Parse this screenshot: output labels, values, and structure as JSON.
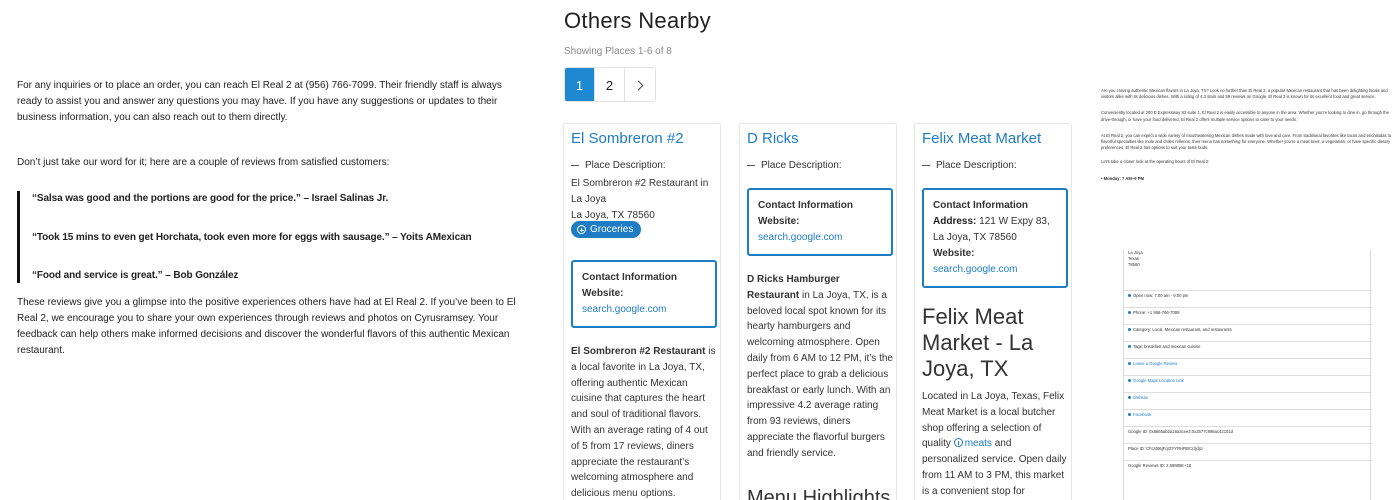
{
  "article": {
    "intro": "For any inquiries or to place an order, you can reach El Real 2 at (956) 766-7099. Their friendly staff is always ready to assist you and answer any questions you may have. If you have any suggestions or updates to their business information, you can also reach out to them directly.",
    "lead": "Don’t just take our word for it; here are a couple of reviews from satisfied customers:",
    "quotes": [
      "“Salsa was good and the portions are good for the price.” – Israel Salinas Jr.",
      "“Took 15 mins to even get Horchata, took even more for eggs with sausage.” – Yoits AMexican",
      "“Food and service is great.” – Bob González"
    ],
    "outro": "These reviews give you a glimpse into the positive experiences others have had at El Real 2. If you’ve been to El Real 2, we encourage you to share your own experiences through reviews and photos on Cyrusramsey. Your feedback can help others make informed decisions and discover the wonderful flavors of this authentic Mexican restaurant."
  },
  "nearby": {
    "title": "Others Nearby",
    "showing": "Showing Places 1-6 of 8",
    "pages": [
      "1",
      "2"
    ],
    "active_page": "1"
  },
  "cards": [
    {
      "title": "El Sombreron #2",
      "place_desc_label": "Place Description:",
      "address_lines": [
        "El Sombreron #2 Restaurant in La Joya",
        "La Joya, TX 78560"
      ],
      "chip": "Groceries",
      "contact_label": "Contact Information",
      "website_label": "Website:",
      "website": "search.google.com",
      "desc_bold": "El Sombreron #2 Restaurant",
      "desc_rest": " is a local favorite in La Joya, TX, offering authentic Mexican cuisine that captures the heart and soul of traditional flavors. With an average rating of 4 out of 5 from 17 reviews, diners appreciate the restaurant’s welcoming atmosphere and delicious menu options."
    },
    {
      "title": "D Ricks",
      "place_desc_label": "Place Description:",
      "contact_label": "Contact Information",
      "website_label": "Website:",
      "website": "search.google.com",
      "desc_bold": "D Ricks Hamburger Restaurant",
      "desc_rest": " in La Joya, TX, is a beloved local spot known for its hearty hamburgers and welcoming atmosphere. Open daily from 6 AM to 12 PM, it’s the perfect place to grab a delicious breakfast or early lunch. With an impressive 4.2 average rating from 93 reviews, diners appreciate the flavorful burgers and friendly service.",
      "menu_heading": "Menu Highlights"
    },
    {
      "title": "Felix Meat Market",
      "place_desc_label": "Place Description:",
      "contact_label": "Contact Information",
      "address_label": "Address:",
      "address": "121 W Expy 83, La Joya, TX 78560",
      "website_label": "Website:",
      "website": "search.google.com",
      "big_title": "Felix Meat Market - La Joya, TX",
      "desc_part1": "Located in La Joya, Texas, Felix Meat Market is a local butcher shop offering a selection of quality ",
      "desc_link": "meats",
      "desc_part2": " and personalized service. Open daily from 11 AM to 3 PM, this market is a convenient stop for"
    }
  ],
  "thumbnail": {
    "p1": "Are you craving authentic Mexican flavors in La Joya, TX? Look no further than El Real 2, a popular Mexican restaurant that has been delighting locals and visitors alike with its delicious dishes. With a rating of 4.3 stars and 59 reviews on Google, El Real 2 is known for its excellent food and great service.",
    "p2": "Conveniently located at 200 E Expressway 83 suite 1, El Real 2 is easily accessible to anyone in the area. Whether you’re looking to dine in, go through the drive-through, or have your food delivered, El Real 2 offers multiple service options to cater to your needs.",
    "p3": "At El Real 2, you can expect a wide variety of mouthwatering Mexican dishes made with love and care. From traditional favorites like tacos and enchiladas to flavorful specialties like mole and chiles rellenos, their menu has something for everyone. Whether you’re a meat lover, a vegetarian, or have specific dietary preferences, El Real 2 has options to suit your taste buds.",
    "p4": "Let’s take a closer look at the operating hours of El Real 2:",
    "hours": "Monday: 7 AM–9 PM",
    "addr_lines": [
      "La Joya",
      "Texas",
      "78560"
    ],
    "rows": [
      "Open now: 7:00 am - 9:00 pm",
      "Phone: +1 956-766-7099",
      "Category: Local, Mexican restaurant, and restaurants",
      "Tags: breakfast and mexican cuisine",
      "Leave a Google Review",
      "Google Maps Location Link",
      "Website",
      "Facebook",
      "Google ID: 0x8665ab2a16a3cee3:0x2577c998ac42101d",
      "Place ID: ChIJ486jFqrZYYRHRBCrJjdjU",
      "Google Reviews ID: 2.69985E+18"
    ]
  }
}
